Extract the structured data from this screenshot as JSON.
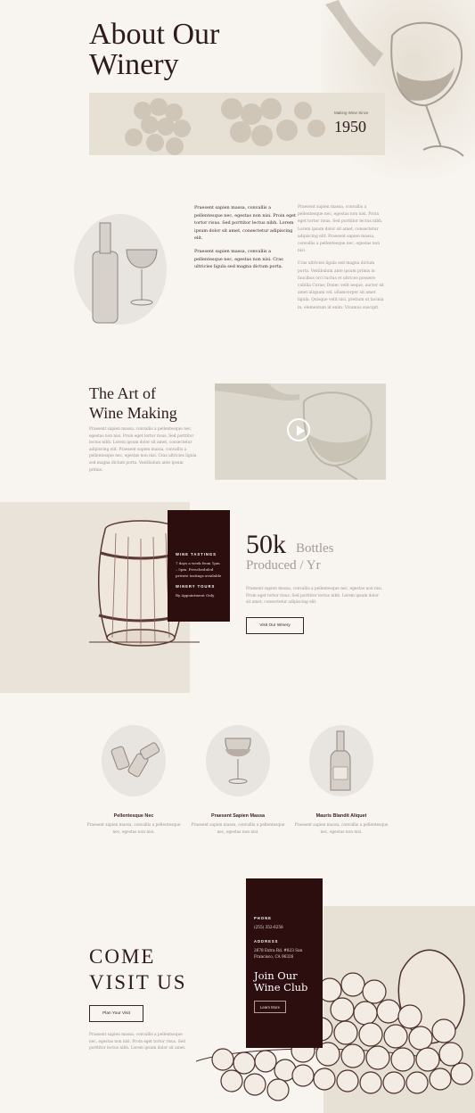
{
  "hero": {
    "title_line1": "About Our",
    "title_line2": "Winery",
    "since_label": "Making Wine Since",
    "since_year": "1950"
  },
  "about": {
    "col1": [
      "Praesent sapien massa, convallis a pellentesque nec, egestas non nisi. Proin eget tortor risus. Sed porttitor lectus nibh. Lorem ipsum dolor sit amet, consectetur adipiscing elit.",
      "Praesent sapien massa, convallis a pellentesque nec, egestas non nisi. Cras ultricies ligula sed magna dictum porta."
    ],
    "col2": [
      "Praesent sapien massa, convallis a pellentesque nec, egestas non nisi. Proin eget tortor risus. Sed porttitor lectus nibh. Lorem ipsum dolor sit amet, consectetur adipiscing elit. Praesent sapien massa, convallis a pellentesque nec, egestas non nisi.",
      "Cras ultricies ligula sed magna dictum porta. Vestibulum ante ipsum primis in faucibus orci luctus et ultrices posuere cubilia Curae; Donec velit neque, auctor sit amet aliquam vel, ullamcorper sit amet ligula. Quisque velit nisi, pretium ut lacinia in, elementum id enim. Vivamus suscipit."
    ]
  },
  "art": {
    "title_line1": "The Art of",
    "title_line2": "Wine Making",
    "body": "Praesent sapien massa, convallis a pellentesque nec, egestas non nisi. Proin eget tortor risus. Sed porttitor lectus nibh. Lorem ipsum dolor sit amet, consectetur adipiscing elit. Praesent sapien massa, convallis a pellentesque nec, egestas non nisi. Cras ultricies ligula sed magna dictum porta. Vestibulum ante ipsum primis."
  },
  "production": {
    "tastings_label": "WINE TASTINGS",
    "tastings_text": "7 days a week from 1pm – 5pm. Prescheduled private tastings available",
    "tours_label": "WINERY TOURS",
    "tours_text": "By Appointment Only",
    "number": "50k",
    "unit1": "Bottles",
    "unit2": "Produced / Yr",
    "body": "Praesent sapien massa, convallis a pellentesque nec, egestas non nisi. Proin eget tortor risus. Sed porttitor lectus nibh. Lorem ipsum dolor sit amet, consectetur adipiscing elit.",
    "button": "Visit Our Winery"
  },
  "features": [
    {
      "title": "Pellentesque Nec",
      "desc": "Praesent sapien massa, convallis a pellentesque nec, egestas non nisi."
    },
    {
      "title": "Praesent Sapien Massa",
      "desc": "Praesent sapien massa, convallis a pellentesque nec, egestas non nisi."
    },
    {
      "title": "Mauris Blandit Aliquet",
      "desc": "Praesent sapien massa, convallis a pellentesque nec, egestas non nisi."
    }
  ],
  "visit": {
    "title_line1": "COME",
    "title_line2": "VISIT US",
    "button": "Plan Your Visit",
    "body": "Praesent sapien massa, convallis a pellentesque nec, egestas non nisi. Proin eget tortor risus. Sed porttitor lectus nibh. Lorem ipsum dolor sit amet.",
    "phone_label": "PHONE",
    "phone": "(255) 352-6258",
    "address_label": "ADDRESS",
    "address": "2678 Extra Rd. #823 San Francisco, CA 96326",
    "club_line1": "Join Our",
    "club_line2": "Wine Club",
    "club_button": "Learn More"
  },
  "colors": {
    "background": "#f8f4ef",
    "dark_accent": "#2d0e0f",
    "heading": "#2e1c1d"
  }
}
